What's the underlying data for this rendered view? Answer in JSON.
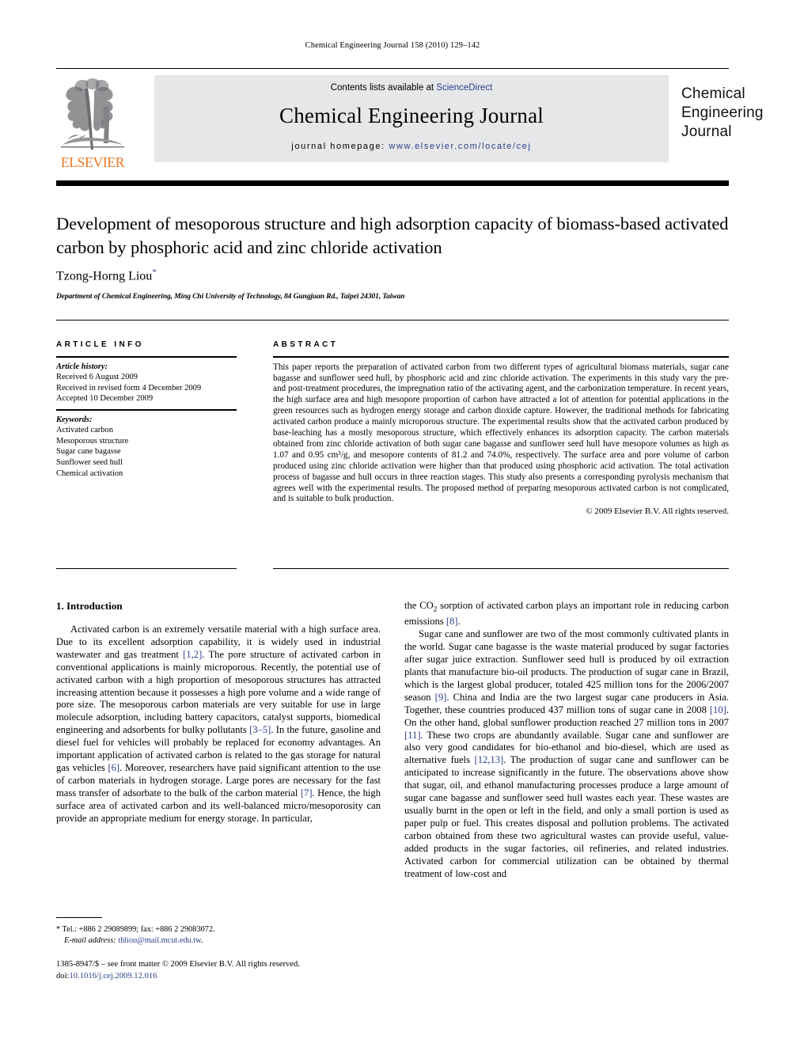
{
  "running_head": "Chemical Engineering Journal 158 (2010) 129–142",
  "masthead": {
    "contents_prefix": "Contents lists available at ",
    "sciencedirect": "ScienceDirect",
    "journal_name": "Chemical Engineering Journal",
    "homepage_prefix": "journal homepage: ",
    "homepage_url": "www.elsevier.com/locate/cej",
    "publisher_wordmark": "ELSEVIER",
    "cover_title_line1": "Chemical",
    "cover_title_line2": "Engineering",
    "cover_title_line3": "Journal",
    "accent_color": "#E87722",
    "link_color": "#2b3f8c",
    "band_color": "#e6e7e8"
  },
  "article": {
    "title": "Development of mesoporous structure and high adsorption capacity of biomass-based activated carbon by phosphoric acid and zinc chloride activation",
    "author": "Tzong-Horng Liou",
    "author_marker": "*",
    "affiliation": "Department of Chemical Engineering, Ming Chi University of Technology, 84 Gungjuan Rd., Taipei 24301, Taiwan"
  },
  "info": {
    "heading": "ARTICLE INFO",
    "history_label": "Article history:",
    "history": [
      "Received 6 August 2009",
      "Received in revised form 4 December 2009",
      "Accepted 10 December 2009"
    ],
    "keywords_label": "Keywords:",
    "keywords": [
      "Activated carbon",
      "Mesoporous structure",
      "Sugar cane bagasse",
      "Sunflower seed hull",
      "Chemical activation"
    ]
  },
  "abstract": {
    "heading": "ABSTRACT",
    "text": "This paper reports the preparation of activated carbon from two different types of agricultural biomass materials, sugar cane bagasse and sunflower seed hull, by phosphoric acid and zinc chloride activation. The experiments in this study vary the pre- and post-treatment procedures, the impregnation ratio of the activating agent, and the carbonization temperature. In recent years, the high surface area and high mesopore proportion of carbon have attracted a lot of attention for potential applications in the green resources such as hydrogen energy storage and carbon dioxide capture. However, the traditional methods for fabricating activated carbon produce a mainly microporous structure. The experimental results show that the activated carbon produced by base-leaching has a mostly mesoporous structure, which effectively enhances its adsorption capacity. The carbon materials obtained from zinc chloride activation of both sugar cane bagasse and sunflower seed hull have mesopore volumes as high as 1.07 and 0.95 cm³/g, and mesopore contents of 81.2 and 74.0%, respectively. The surface area and pore volume of carbon produced using zinc chloride activation were higher than that produced using phosphoric acid activation. The total activation process of bagasse and hull occurs in three reaction stages. This study also presents a corresponding pyrolysis mechanism that agrees well with the experimental results. The proposed method of preparing mesoporous activated carbon is not complicated, and is suitable to bulk production.",
    "copyright": "© 2009 Elsevier B.V. All rights reserved."
  },
  "introduction": {
    "heading": "1. Introduction",
    "left_para1_a": "Activated carbon is an extremely versatile material with a high surface area. Due to its excellent adsorption capability, it is widely used in industrial wastewater and gas treatment ",
    "left_ref_1_2": "[1,2]",
    "left_para1_b": ". The pore structure of activated carbon in conventional applications is mainly microporous. Recently, the potential use of activated carbon with a high proportion of mesoporous structures has attracted increasing attention because it possesses a high pore volume and a wide range of pore size. The mesoporous carbon materials are very suitable for use in large molecule adsorption, including battery capacitors, catalyst supports, biomedical engineering and adsorbents for bulky pollutants ",
    "left_ref_3_5": "[3–5]",
    "left_para1_c": ". In the future, gasoline and diesel fuel for vehicles will probably be replaced for economy advantages. An important application of activated carbon is related to the gas storage for natural gas vehicles ",
    "left_ref_6": "[6]",
    "left_para1_d": ". Moreover, researchers have paid significant attention to the use of carbon materials in hydrogen storage. Large pores are necessary for the fast mass transfer of adsorbate to the bulk of the carbon material ",
    "left_ref_7": "[7]",
    "left_para1_e": ". Hence, the high surface area of activated carbon and its well-balanced micro/mesoporosity can provide an appropriate medium for energy storage. In particular,",
    "right_para1_a": "the CO",
    "right_para1_sub": "2",
    "right_para1_b": " sorption of activated carbon plays an important role in reducing carbon emissions ",
    "right_ref_8": "[8]",
    "right_para1_c": ".",
    "right_para2_a": "Sugar cane and sunflower are two of the most commonly cultivated plants in the world. Sugar cane bagasse is the waste material produced by sugar factories after sugar juice extraction. Sunflower seed hull is produced by oil extraction plants that manufacture bio-oil products. The production of sugar cane in Brazil, which is the largest global producer, totaled 425 million tons for the 2006/2007 season ",
    "right_ref_9": "[9]",
    "right_para2_b": ". China and India are the two largest sugar cane producers in Asia. Together, these countries produced 437 million tons of sugar cane in 2008 ",
    "right_ref_10": "[10]",
    "right_para2_c": ". On the other hand, global sunflower production reached 27 million tons in 2007 ",
    "right_ref_11": "[11]",
    "right_para2_d": ". These two crops are abundantly available. Sugar cane and sunflower are also very good candidates for bio-ethanol and bio-diesel, which are used as alternative fuels ",
    "right_ref_12_13": "[12,13]",
    "right_para2_e": ". The production of sugar cane and sunflower can be anticipated to increase significantly in the future. The observations above show that sugar, oil, and ethanol manufacturing processes produce a large amount of sugar cane bagasse and sunflower seed hull wastes each year. These wastes are usually burnt in the open or left in the field, and only a small portion is used as paper pulp or fuel. This creates disposal and pollution problems. The activated carbon obtained from these two agricultural wastes can provide useful, value-added products in the sugar factories, oil refineries, and related industries. Activated carbon for commercial utilization can be obtained by thermal treatment of low-cost and"
  },
  "footnote": {
    "marker": "*",
    "contact": "Tel.: +886 2 29089899; fax: +886 2 29083072.",
    "email_label": "E-mail address:",
    "email": "thliou@mail.mcut.edu.tw"
  },
  "footer": {
    "front_matter": "1385-8947/$ – see front matter © 2009 Elsevier B.V. All rights reserved.",
    "doi_label": "doi:",
    "doi_number": "10.1016/j.cej.2009.12.016"
  }
}
